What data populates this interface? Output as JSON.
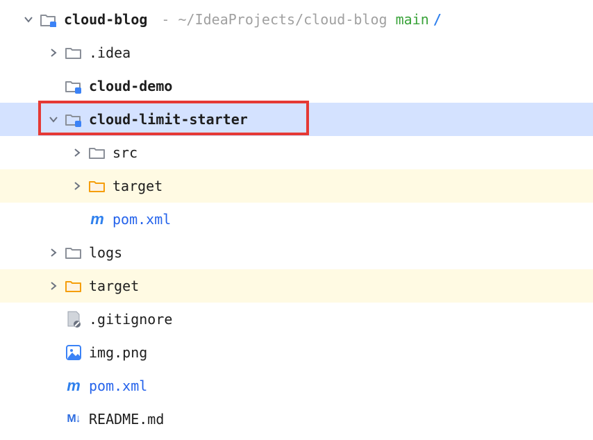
{
  "root": {
    "name": "cloud-blog",
    "path": "~/IdeaProjects/cloud-blog",
    "branch": "main",
    "divider": "/"
  },
  "tree": [
    {
      "label": ".idea",
      "icon": "folder",
      "chevron": "right",
      "indent": 1
    },
    {
      "label": "cloud-demo",
      "icon": "module",
      "chevron": "none",
      "indent": 1,
      "bold": true
    },
    {
      "label": "cloud-limit-starter",
      "icon": "module",
      "chevron": "down",
      "indent": 1,
      "bold": true,
      "selected": true,
      "redbox": true
    },
    {
      "label": "src",
      "icon": "folder",
      "chevron": "right",
      "indent": 2
    },
    {
      "label": "target",
      "icon": "folder-orange",
      "chevron": "right",
      "indent": 2,
      "highlighted": true
    },
    {
      "label": "pom.xml",
      "icon": "maven",
      "chevron": "none",
      "indent": 2,
      "blue": true
    },
    {
      "label": "logs",
      "icon": "folder",
      "chevron": "right",
      "indent": 1
    },
    {
      "label": "target",
      "icon": "folder-orange",
      "chevron": "right",
      "indent": 1,
      "highlighted": true
    },
    {
      "label": ".gitignore",
      "icon": "gitignore",
      "chevron": "none",
      "indent": 1
    },
    {
      "label": "img.png",
      "icon": "image",
      "chevron": "none",
      "indent": 1
    },
    {
      "label": "pom.xml",
      "icon": "maven",
      "chevron": "none",
      "indent": 1,
      "blue": true
    },
    {
      "label": "README.md",
      "icon": "markdown",
      "chevron": "none",
      "indent": 1
    }
  ]
}
